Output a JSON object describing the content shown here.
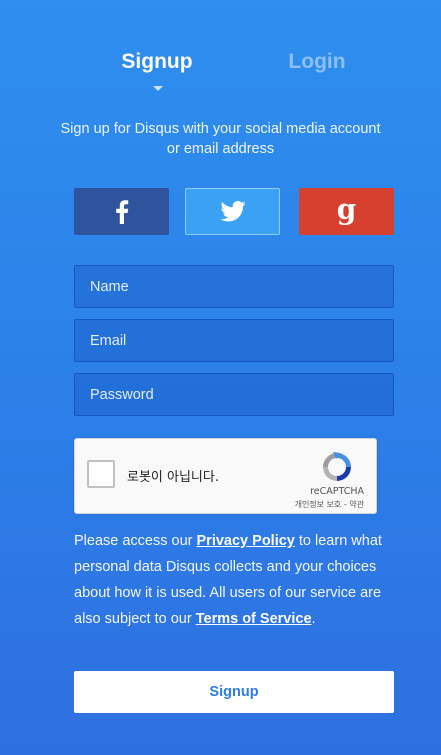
{
  "tabs": {
    "signup": "Signup",
    "login": "Login"
  },
  "subtitle": "Sign up for Disqus with your social media account or email address",
  "social": {
    "facebook_icon": "facebook-f",
    "twitter_icon": "twitter-bird",
    "google_icon": "google-g"
  },
  "form": {
    "name_placeholder": "Name",
    "email_placeholder": "Email",
    "password_placeholder": "Password"
  },
  "captcha": {
    "label": "로봇이 아닙니다.",
    "brand": "reCAPTCHA",
    "privacy_link": "개인정보 보호",
    "separator": " - ",
    "terms_link": "약관"
  },
  "privacy": {
    "part1": "Please access our ",
    "privacy_link": "Privacy Policy",
    "part2": " to learn what personal data Disqus collects and your choices about how it is used. All users of our service are also subject to our ",
    "terms_link": "Terms of Service",
    "part3": "."
  },
  "submit_label": "Signup",
  "colors": {
    "facebook": "#2f539c",
    "twitter": "#3ba1f3",
    "google": "#d6402f",
    "background": "#2c7fe8"
  }
}
